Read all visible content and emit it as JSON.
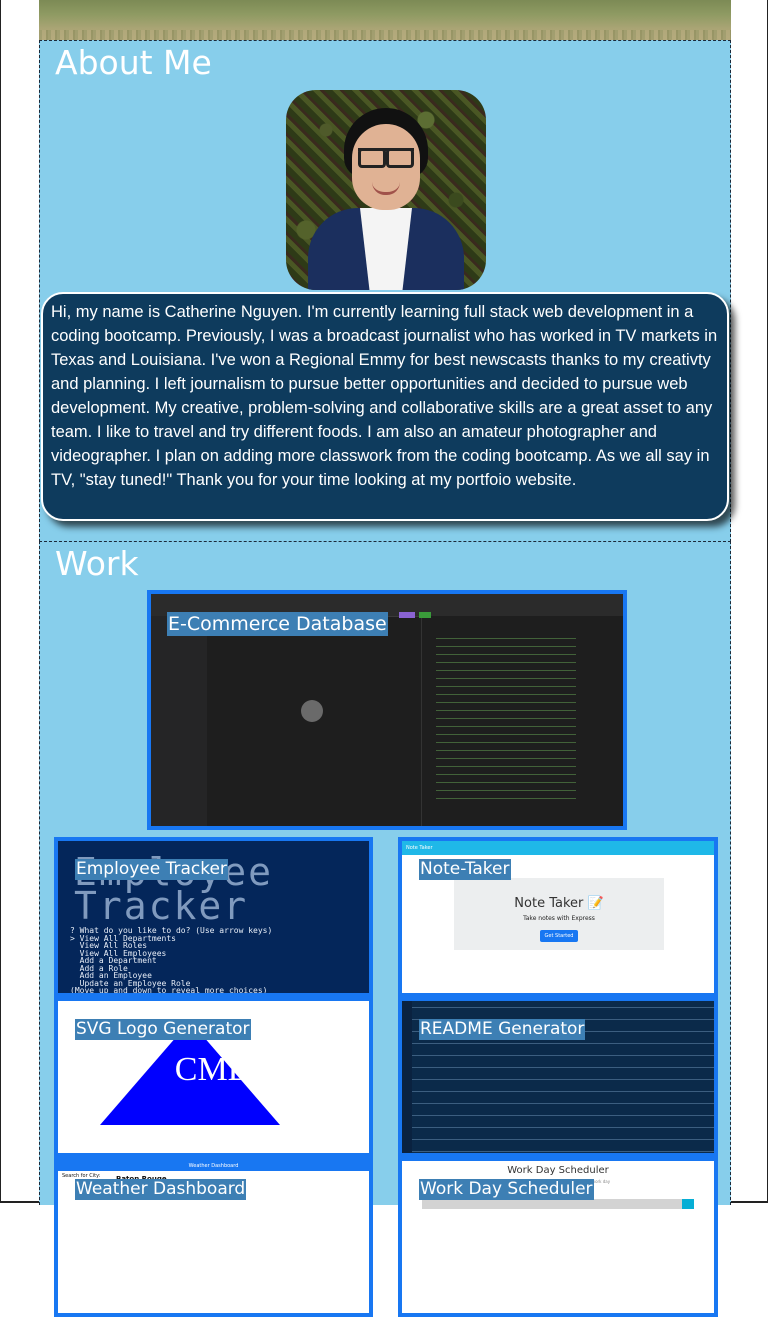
{
  "about": {
    "title": "About Me",
    "bio": "Hi, my name is Catherine Nguyen. I'm currently learning full stack web development in a coding bootcamp. Previously, I was a broadcast journalist who has worked in TV markets in Texas and Louisiana. I've won a Regional Emmy for best newscasts thanks to my creativty and planning. I left journalism to pursue better opportunities and decided to pursue web development. My creative, problem-solving and collaborative skills are a great asset to any team. I like to travel and try different foods. I am also an amateur photographer and videographer. I plan on adding more classwork from the coding bootcamp. As we all say in TV, \"stay tuned!\" Thank you for your time looking at my portfoio website."
  },
  "work": {
    "title": "Work",
    "projects": [
      {
        "label": "E-Commerce Database"
      },
      {
        "label": "Employee Tracker"
      },
      {
        "label": "Note-Taker"
      },
      {
        "label": "SVG Logo Generator"
      },
      {
        "label": "README Generator"
      },
      {
        "label": "Weather Dashboard"
      },
      {
        "label": "Work Day Scheduler"
      }
    ]
  },
  "thumbnails": {
    "employee_big_text": "Employee\nTracker",
    "employee_menu": "? What do you like to do? (Use arrow keys)\n> View All Departments\n  View All Roles\n  View All Employees\n  Add a Department\n  Add a Role\n  Add an Employee\n  Update an Employee Role\n(Move up and down to reveal more choices)",
    "note_bar": "Note Taker",
    "note_title": "Note Taker 📝",
    "note_subtitle": "Take notes with Express",
    "note_button": "Get Started",
    "svg_text": "CMD",
    "weather_bar": "Weather Dashboard",
    "weather_search": "Search for City:",
    "weather_city": "Baton Rouge",
    "scheduler_title": "Work Day Scheduler",
    "scheduler_subtitle": "A simple calendar app for scheduling your work day"
  },
  "colors": {
    "section_bg": "#87ceeb",
    "bio_bg": "#0e3b5d",
    "card_border": "#1877f2",
    "label_bg": "#3d7fb4"
  }
}
